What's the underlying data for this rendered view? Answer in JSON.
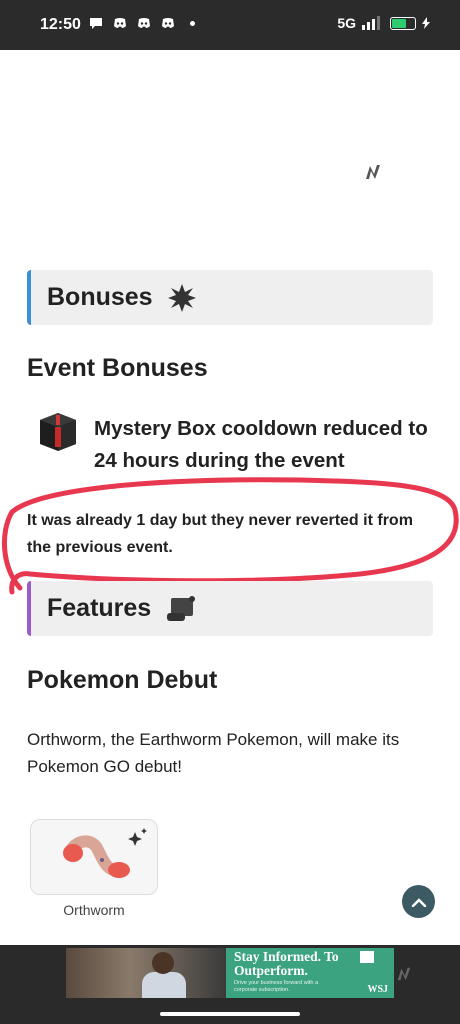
{
  "status_bar": {
    "time": "12:50",
    "network": "5G",
    "battery_level": 0.6
  },
  "sections": {
    "bonuses": {
      "title": "Bonuses",
      "accent": "#3a8fd6",
      "icon": "starburst-icon"
    },
    "features": {
      "title": "Features",
      "accent": "#9a5cc6",
      "icon": "scroll-icon"
    }
  },
  "event_bonuses": {
    "heading": "Event Bonuses",
    "item_text": "Mystery Box cooldown reduced to 24 hours during the event",
    "item_icon": "mystery-box-icon"
  },
  "annotation": {
    "note": "It was already 1 day but they never reverted it from the previous event.",
    "circle_color": "#e8384f"
  },
  "pokemon_debut": {
    "heading": "Pokemon Debut",
    "paragraph": "Orthworm, the Earthworm Pokemon, will make its Pokemon GO debut!",
    "card_label": "Orthworm"
  },
  "ad": {
    "headline": "Stay Informed. To Outperform.",
    "subtext": "Drive your business forward with a corporate subscription.",
    "brand": "WSJ"
  }
}
